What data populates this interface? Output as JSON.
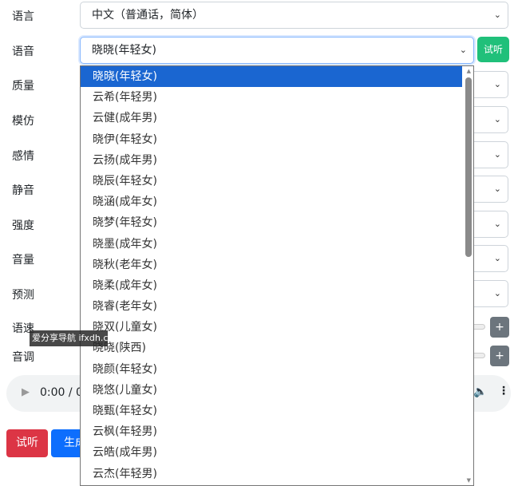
{
  "labels": {
    "language": "语言",
    "voice": "语音",
    "quality": "质量",
    "imitate": "模仿",
    "emotion": "感情",
    "mute": "静音",
    "intensity": "强度",
    "volume": "音量",
    "preset": "预测",
    "rate": "语速",
    "pitch": "音调"
  },
  "language_value": "中文（普通话，简体）",
  "voice_value": "晓晓(年轻女)",
  "voice_try_label": "试听",
  "plus_label": "+",
  "audio": {
    "time": "0:00 / 0:00"
  },
  "voice_options": [
    "晓晓(年轻女)",
    "云希(年轻男)",
    "云健(成年男)",
    "晓伊(年轻女)",
    "云扬(成年男)",
    "晓辰(年轻女)",
    "晓涵(成年女)",
    "晓梦(年轻女)",
    "晓墨(成年女)",
    "晓秋(老年女)",
    "晓柔(成年女)",
    "晓睿(老年女)",
    "晓双(儿童女)",
    "晓晓(陕西)",
    "晓颜(年轻女)",
    "晓悠(儿童女)",
    "晓甄(年轻女)",
    "云枫(年轻男)",
    "云皓(成年男)",
    "云杰(年轻男)"
  ],
  "selected_option_index": 0,
  "buttons": {
    "try": "试听",
    "generate": "生成"
  },
  "watermark": "爱分享导航 ifxdh.com",
  "colors": {
    "selected": "#1a66d1",
    "try_red": "#dc3545",
    "generate_blue": "#0d6efd",
    "try_green": "#20c07a"
  }
}
